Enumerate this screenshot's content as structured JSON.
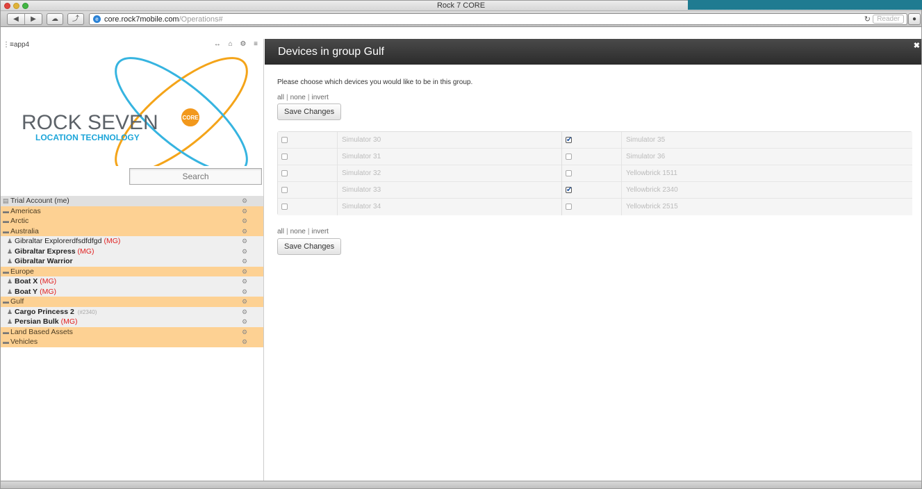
{
  "browser": {
    "window_title": "Rock 7 CORE",
    "url_host": "core.rock7mobile.com",
    "url_path": "/Operations#",
    "reader_label": "Reader",
    "reload_glyph": "↻",
    "back_glyph": "◀",
    "forward_glyph": "▶",
    "cloud_glyph": "☁",
    "share_glyph": "⤴",
    "ext_glyph": "●",
    "globe_glyph": "e"
  },
  "sidebar": {
    "app_name": "app4",
    "app_prefix_glyph": "⋮≡",
    "top_icons": "↔ ⌂ ⚙ ≡",
    "logo": {
      "brand": "ROCK SEVEN",
      "tagline": "LOCATION TECHNOLOGY",
      "badge": "CORE",
      "colors": {
        "brand": "#5c6268",
        "tagline": "#1ea6d9",
        "orbit_orange": "#f4a419",
        "orbit_blue": "#36b4e0",
        "badge": "#f2981c"
      }
    },
    "search_placeholder": "Search",
    "tree": [
      {
        "type": "account",
        "icon": "account-icon",
        "label": "Trial Account (me)"
      },
      {
        "type": "group",
        "icon": "folder-icon",
        "label": "Americas"
      },
      {
        "type": "group",
        "icon": "folder-icon",
        "label": "Arctic"
      },
      {
        "type": "group",
        "icon": "folder-icon",
        "label": "Australia"
      },
      {
        "type": "device",
        "icon": "person-icon",
        "label": "Gibraltar Explorerdfsdfdfgd",
        "bold": false,
        "mg": "(MG)"
      },
      {
        "type": "device",
        "icon": "person-icon",
        "label": "Gibraltar Express",
        "bold": true,
        "mg": "(MG)"
      },
      {
        "type": "device",
        "icon": "person-icon",
        "label": "Gibraltar Warrior",
        "bold": true,
        "mg": ""
      },
      {
        "type": "group",
        "icon": "folder-icon",
        "label": "Europe"
      },
      {
        "type": "device",
        "icon": "person-icon",
        "label": "Boat X",
        "bold": true,
        "mg": "(MG)"
      },
      {
        "type": "device",
        "icon": "person-icon",
        "label": "Boat Y",
        "bold": true,
        "mg": "(MG)"
      },
      {
        "type": "group",
        "icon": "folder-icon",
        "label": "Gulf"
      },
      {
        "type": "device",
        "icon": "person-icon",
        "label": "Cargo Princess 2",
        "bold": true,
        "mg": "",
        "sub": "(#2340)"
      },
      {
        "type": "device",
        "icon": "person-icon",
        "label": "Persian Bulk",
        "bold": true,
        "mg": "(MG)"
      },
      {
        "type": "group",
        "icon": "folder-icon",
        "label": "Land Based Assets"
      },
      {
        "type": "group",
        "icon": "folder-icon",
        "label": "Vehicles"
      }
    ]
  },
  "main": {
    "title": "Devices in group Gulf",
    "close_glyph": "✖",
    "intro": "Please choose which devices you would like to be in this group.",
    "links": {
      "all": "all",
      "none": "none",
      "invert": "invert",
      "sep": "|"
    },
    "save_label": "Save Changes",
    "devices_left": [
      {
        "name": "Simulator 30",
        "checked": false
      },
      {
        "name": "Simulator 31",
        "checked": false
      },
      {
        "name": "Simulator 32",
        "checked": false
      },
      {
        "name": "Simulator 33",
        "checked": false
      },
      {
        "name": "Simulator 34",
        "checked": false
      }
    ],
    "devices_right": [
      {
        "name": "Simulator 35",
        "checked": true
      },
      {
        "name": "Simulator 36",
        "checked": false
      },
      {
        "name": "Yellowbrick 1511",
        "checked": false
      },
      {
        "name": "Yellowbrick 2340",
        "checked": true
      },
      {
        "name": "Yellowbrick 2515",
        "checked": false
      }
    ],
    "check_glyph": "✔"
  }
}
